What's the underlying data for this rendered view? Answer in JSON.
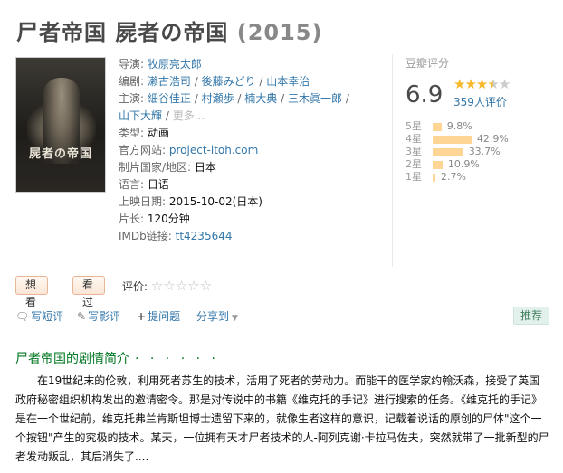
{
  "title": {
    "main": "尸者帝国 屍者の帝国",
    "year": "(2015)"
  },
  "poster": {
    "title_text": "屍者の帝国"
  },
  "info": {
    "director": {
      "label": "导演:",
      "values": [
        "牧原亮太郎"
      ]
    },
    "writers": {
      "label": "编剧:",
      "values": [
        "濑古浩司",
        "後藤みどり",
        "山本幸治"
      ]
    },
    "cast": {
      "label": "主演:",
      "values": [
        "細谷佳正",
        "村瀬歩",
        "楠大典",
        "三木眞一郎",
        "山下大輝"
      ],
      "more": "更多..."
    },
    "genre": {
      "label": "类型:",
      "value": "动画"
    },
    "site": {
      "label": "官方网站:",
      "value": "project-itoh.com"
    },
    "country": {
      "label": "制片国家/地区:",
      "value": "日本"
    },
    "language": {
      "label": "语言:",
      "value": "日语"
    },
    "release": {
      "label": "上映日期:",
      "value": "2015-10-02(日本)"
    },
    "runtime": {
      "label": "片长:",
      "value": "120分钟"
    },
    "imdb": {
      "label": "IMDb链接:",
      "value": "tt4235644"
    }
  },
  "rating": {
    "label": "豆瓣评分",
    "score": "6.9",
    "stars_filled": 3.5,
    "votes": "359人评价",
    "distribution": [
      {
        "label": "5星",
        "percent_text": "9.8%",
        "percent": 9.8
      },
      {
        "label": "4星",
        "percent_text": "42.9%",
        "percent": 42.9
      },
      {
        "label": "3星",
        "percent_text": "33.7%",
        "percent": 33.7
      },
      {
        "label": "2星",
        "percent_text": "10.9%",
        "percent": 10.9
      },
      {
        "label": "1星",
        "percent_text": "2.7%",
        "percent": 2.7
      }
    ]
  },
  "actions": {
    "want": "想看",
    "seen": "看过",
    "eval_label": "评价:"
  },
  "social": {
    "write_short": "写短评",
    "write_review": "写影评",
    "ask": "提问题",
    "share": "分享到",
    "recommend": "推荐"
  },
  "synopsis": {
    "heading": "尸者帝国的剧情简介",
    "dots": "· · · · · ·",
    "text": "在19世纪末的伦敦，利用死者苏生的技术，活用了死者的劳动力。而能干的医学家约翰沃森，接受了英国政府秘密组织机构发出的邀请密令。那是对传说中的书籍《维克托的手记》进行搜索的任务。《维克托的手记》是在一个世纪前，维克托弗兰肯斯坦博士遗留下来的，就像生者这样的意识，记载着说话的原创的尸体\"这个一个按钮\"产生的究极的技术。某天，一位拥有天才尸者技术的人-阿列克谢·卡拉马佐夫，突然就带了一批新型的尸者发动叛乱，其后消失了...."
  }
}
